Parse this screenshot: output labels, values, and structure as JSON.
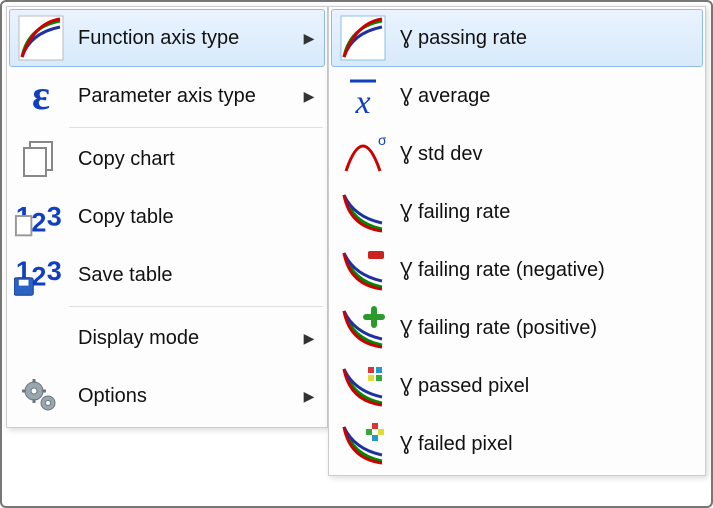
{
  "main_menu": {
    "items": [
      {
        "label": "Function axis type",
        "has_submenu": true,
        "selected": true
      },
      {
        "label": "Parameter axis type",
        "has_submenu": true,
        "selected": false
      },
      {
        "label": "Copy chart",
        "has_submenu": false,
        "selected": false
      },
      {
        "label": "Copy table",
        "has_submenu": false,
        "selected": false
      },
      {
        "label": "Save table",
        "has_submenu": false,
        "selected": false
      },
      {
        "label": "Display mode",
        "has_submenu": true,
        "selected": false
      },
      {
        "label": "Options",
        "has_submenu": true,
        "selected": false
      }
    ]
  },
  "sub_menu": {
    "items": [
      {
        "label": "Ɣ passing rate"
      },
      {
        "label": "Ɣ average"
      },
      {
        "label": "Ɣ std dev"
      },
      {
        "label": "Ɣ failing rate"
      },
      {
        "label": "Ɣ failing rate (negative)"
      },
      {
        "label": "Ɣ failing rate (positive)"
      },
      {
        "label": "Ɣ passed pixel"
      },
      {
        "label": "Ɣ failed pixel"
      }
    ]
  },
  "glyphs": {
    "submenu_arrow": "▶"
  }
}
